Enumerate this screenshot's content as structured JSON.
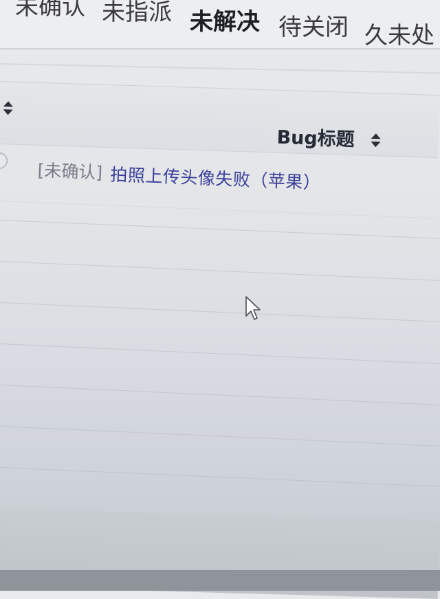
{
  "tabs": [
    {
      "label": "未确认"
    },
    {
      "label": "未指派"
    },
    {
      "label": "未解决"
    },
    {
      "label": "待关闭"
    },
    {
      "label": "久未处"
    }
  ],
  "active_tab": "未解决",
  "table": {
    "columns": [
      {
        "label": "Bug标题",
        "sortable": true
      }
    ],
    "rows": [
      {
        "status": "[未确认]",
        "title": "拍照上传头像失败（苹果）"
      }
    ]
  },
  "icons": {
    "sort": "sort-icon",
    "cursor": "cursor-arrow-icon"
  },
  "colors": {
    "link": "#3a3f9a",
    "status_text": "#7a7d88"
  }
}
